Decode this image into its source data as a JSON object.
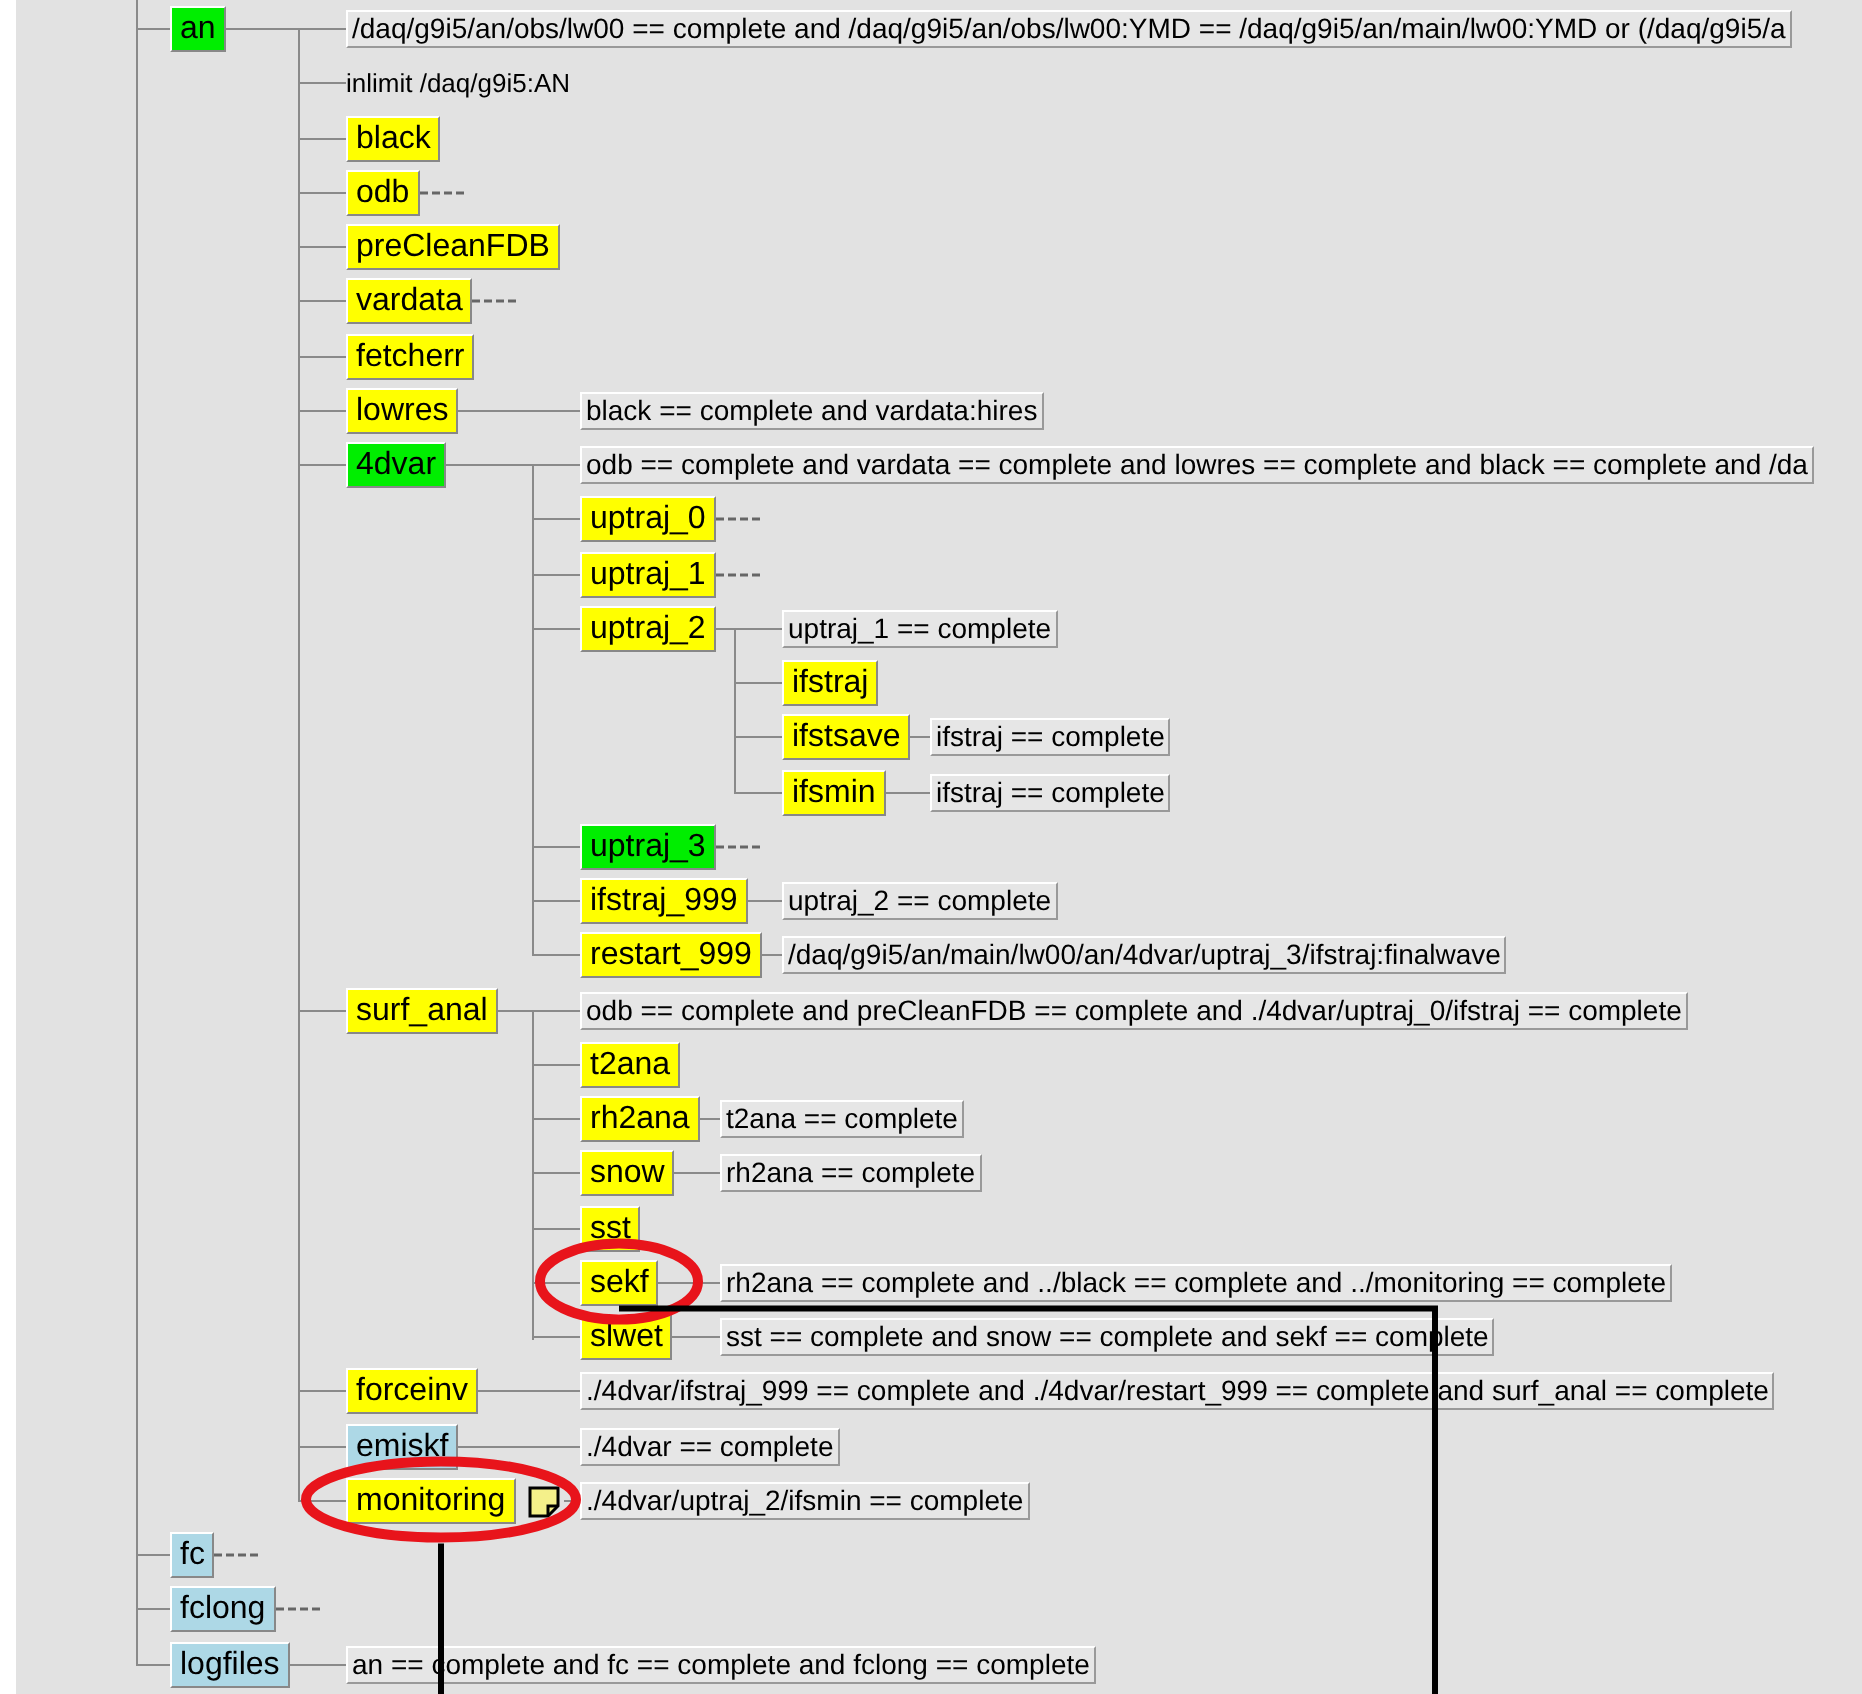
{
  "tree": {
    "nodes": [
      {
        "name": "an",
        "color": "#00ee00",
        "collapsed": false,
        "note": false,
        "trigger": "/daq/g9i5/an/obs/lw00 == complete and /daq/g9i5/an/obs/lw00:YMD == /daq/g9i5/an/main/lw00:YMD or (/daq/g9i5/a",
        "limit": "inlimit /daq/g9i5:AN",
        "children": [
          {
            "name": "black",
            "color": "#ffff00",
            "collapsed": false,
            "note": false
          },
          {
            "name": "odb",
            "color": "#ffff00",
            "collapsed": true,
            "note": false
          },
          {
            "name": "preCleanFDB",
            "color": "#ffff00",
            "collapsed": false,
            "note": false
          },
          {
            "name": "vardata",
            "color": "#ffff00",
            "collapsed": true,
            "note": false
          },
          {
            "name": "fetcherr",
            "color": "#ffff00",
            "collapsed": false,
            "note": false
          },
          {
            "name": "lowres",
            "color": "#ffff00",
            "collapsed": false,
            "note": false,
            "trigger": "black == complete and vardata:hires"
          },
          {
            "name": "4dvar",
            "color": "#00ee00",
            "collapsed": false,
            "note": false,
            "trigger": "odb == complete and vardata == complete and lowres == complete and black == complete and /da",
            "children": [
              {
                "name": "uptraj_0",
                "color": "#ffff00",
                "collapsed": true,
                "note": false
              },
              {
                "name": "uptraj_1",
                "color": "#ffff00",
                "collapsed": true,
                "note": false
              },
              {
                "name": "uptraj_2",
                "color": "#ffff00",
                "collapsed": false,
                "note": false,
                "trigger": "uptraj_1 == complete",
                "children": [
                  {
                    "name": "ifstraj",
                    "color": "#ffff00",
                    "collapsed": false,
                    "note": false
                  },
                  {
                    "name": "ifstsave",
                    "color": "#ffff00",
                    "collapsed": false,
                    "note": false,
                    "trigger": "ifstraj == complete"
                  },
                  {
                    "name": "ifsmin",
                    "color": "#ffff00",
                    "collapsed": false,
                    "note": false,
                    "trigger": "ifstraj == complete"
                  }
                ]
              },
              {
                "name": "uptraj_3",
                "color": "#00ee00",
                "collapsed": true,
                "note": false
              },
              {
                "name": "ifstraj_999",
                "color": "#ffff00",
                "collapsed": false,
                "note": false,
                "trigger": "uptraj_2 == complete"
              },
              {
                "name": "restart_999",
                "color": "#ffff00",
                "collapsed": false,
                "note": false,
                "trigger": "/daq/g9i5/an/main/lw00/an/4dvar/uptraj_3/ifstraj:finalwave"
              }
            ]
          },
          {
            "name": "surf_anal",
            "color": "#ffff00",
            "collapsed": false,
            "note": false,
            "trigger": "odb == complete and preCleanFDB == complete and ./4dvar/uptraj_0/ifstraj == complete",
            "children": [
              {
                "name": "t2ana",
                "color": "#ffff00",
                "collapsed": false,
                "note": false
              },
              {
                "name": "rh2ana",
                "color": "#ffff00",
                "collapsed": false,
                "note": false,
                "trigger": "t2ana == complete"
              },
              {
                "name": "snow",
                "color": "#ffff00",
                "collapsed": false,
                "note": false,
                "trigger": "rh2ana == complete"
              },
              {
                "name": "sst",
                "color": "#ffff00",
                "collapsed": false,
                "note": false
              },
              {
                "name": "sekf",
                "color": "#ffff00",
                "collapsed": false,
                "note": false,
                "trigger": "rh2ana == complete and ../black == complete and ../monitoring == complete",
                "annotation": {
                  "kind": "elbow"
                }
              },
              {
                "name": "slwet",
                "color": "#ffff00",
                "collapsed": false,
                "note": false,
                "trigger": "sst == complete and snow == complete and sekf == complete"
              }
            ]
          },
          {
            "name": "forceinv",
            "color": "#ffff00",
            "collapsed": false,
            "note": false,
            "trigger": "./4dvar/ifstraj_999 == complete and ./4dvar/restart_999 == complete and surf_anal == complete"
          },
          {
            "name": "emiskf",
            "color": "#add8e6",
            "collapsed": false,
            "note": false,
            "trigger": "./4dvar == complete"
          },
          {
            "name": "monitoring",
            "color": "#ffff00",
            "collapsed": false,
            "note": true,
            "trigger": "./4dvar/uptraj_2/ifsmin == complete",
            "annotation": {
              "kind": "down"
            }
          }
        ]
      },
      {
        "name": "fc",
        "color": "#add8e6",
        "collapsed": true,
        "note": false
      },
      {
        "name": "fclong",
        "color": "#add8e6",
        "collapsed": true,
        "note": false
      },
      {
        "name": "logfiles",
        "color": "#add8e6",
        "collapsed": false,
        "note": false,
        "trigger": "an == complete and fc == complete and fclong == complete"
      }
    ]
  }
}
